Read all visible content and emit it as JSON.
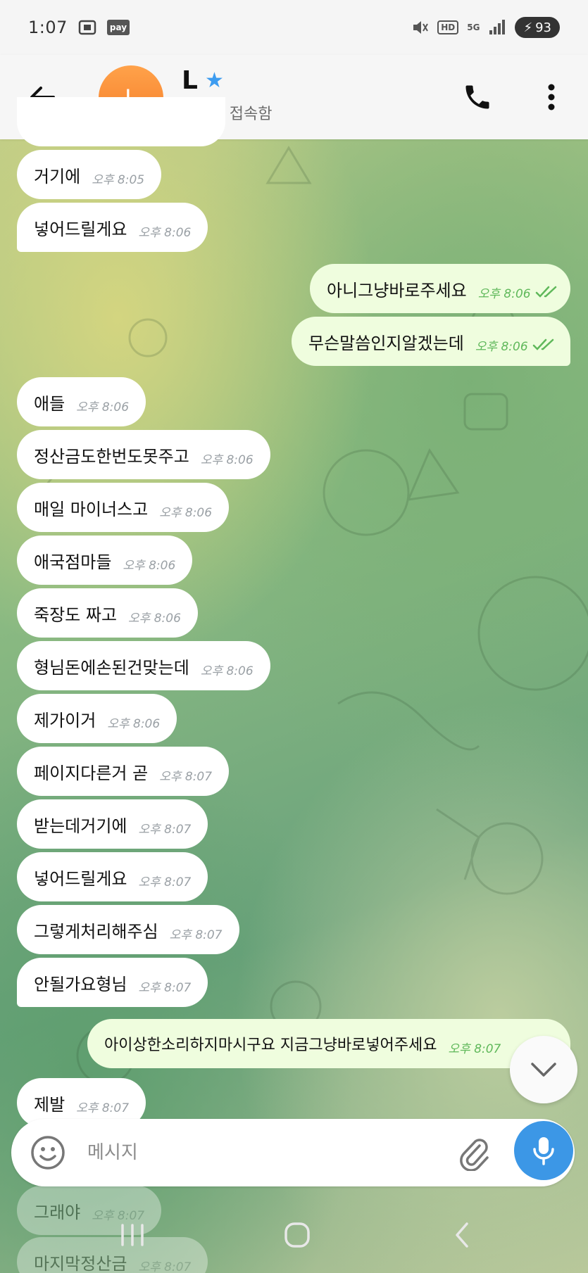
{
  "status_bar": {
    "time": "1:07",
    "pay_label": "pay",
    "hd_label": "HD",
    "network": "5G",
    "battery": "93"
  },
  "header": {
    "contact_name": "L",
    "avatar_initial": "L",
    "contact_status": "최근에 접속함"
  },
  "messages": [
    {
      "dir": "in",
      "text": "거기에",
      "time": "오후 8:05"
    },
    {
      "dir": "in",
      "text": "넣어드릴게요",
      "time": "오후 8:06"
    },
    {
      "dir": "out",
      "text": "아니그냥바로주세요",
      "time": "오후 8:06"
    },
    {
      "dir": "out",
      "text": "무슨말씀인지알겠는데",
      "time": "오후 8:06"
    },
    {
      "dir": "in",
      "text": "애들",
      "time": "오후 8:06"
    },
    {
      "dir": "in",
      "text": "정산금도한번도못주고",
      "time": "오후 8:06"
    },
    {
      "dir": "in",
      "text": "매일 마이너스고",
      "time": "오후 8:06"
    },
    {
      "dir": "in",
      "text": "애국점마들",
      "time": "오후 8:06"
    },
    {
      "dir": "in",
      "text": "죽장도 짜고",
      "time": "오후 8:06"
    },
    {
      "dir": "in",
      "text": "형님돈에손된건맞는데",
      "time": "오후 8:06"
    },
    {
      "dir": "in",
      "text": "제가이거",
      "time": "오후 8:06"
    },
    {
      "dir": "in",
      "text": "페이지다른거 곧",
      "time": "오후 8:07"
    },
    {
      "dir": "in",
      "text": "받는데거기에",
      "time": "오후 8:07"
    },
    {
      "dir": "in",
      "text": "넣어드릴게요",
      "time": "오후 8:07"
    },
    {
      "dir": "in",
      "text": "그렇게처리해주심",
      "time": "오후 8:07"
    },
    {
      "dir": "in",
      "text": "안될가요형님",
      "time": "오후 8:07"
    },
    {
      "dir": "out",
      "text": "아이상한소리하지마시구요 지금그냥바로넣어주세요",
      "time": "오후 8:07"
    },
    {
      "dir": "in",
      "text": "제발",
      "time": "오후 8:07"
    },
    {
      "dir": "in",
      "text": "그래야",
      "time": "오후 8:07"
    },
    {
      "dir": "in",
      "text": "마지막정산금",
      "time": "오후 8:07"
    }
  ],
  "input": {
    "placeholder": "메시지"
  },
  "colors": {
    "accent": "#3c97e6",
    "avatar": "#f5882f",
    "outgoing_bubble": "#effdde",
    "incoming_bubble": "#ffffff",
    "check": "#5fb85a"
  }
}
